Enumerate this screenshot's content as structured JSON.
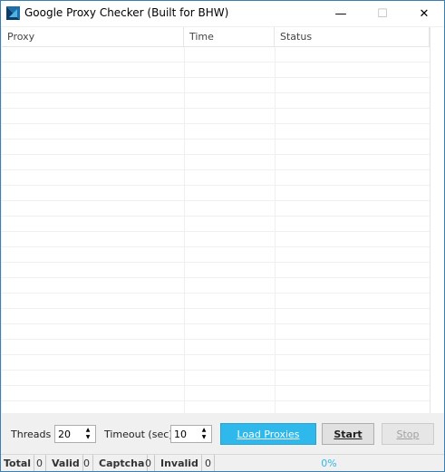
{
  "window": {
    "title": "Google Proxy Checker (Built for BHW)",
    "minimize_glyph": "—",
    "maximize_glyph": "☐",
    "close_glyph": "✕"
  },
  "grid": {
    "columns": [
      {
        "label": "Proxy"
      },
      {
        "label": "Time"
      },
      {
        "label": "Status"
      }
    ],
    "rows": []
  },
  "controls": {
    "threads_label": "Threads",
    "threads_value": "20",
    "timeout_label": "Timeout (sec)",
    "timeout_value": "10",
    "load_label": "Load Proxies",
    "start_label": "Start",
    "stop_label": "Stop"
  },
  "statusbar": {
    "total_label": "Total",
    "total_value": "0",
    "valid_label": "Valid",
    "valid_value": "0",
    "captcha_label": "Captcha",
    "captcha_value": "0",
    "invalid_label": "Invalid",
    "invalid_value": "0",
    "progress_text": "0%",
    "progress_fraction": 0
  },
  "colors": {
    "accent": "#2fb8ec",
    "window_border": "#3c7fb1"
  },
  "icons": {
    "app": "app-logo-icon",
    "spin_up": "up-arrow-icon",
    "spin_down": "down-arrow-icon"
  }
}
